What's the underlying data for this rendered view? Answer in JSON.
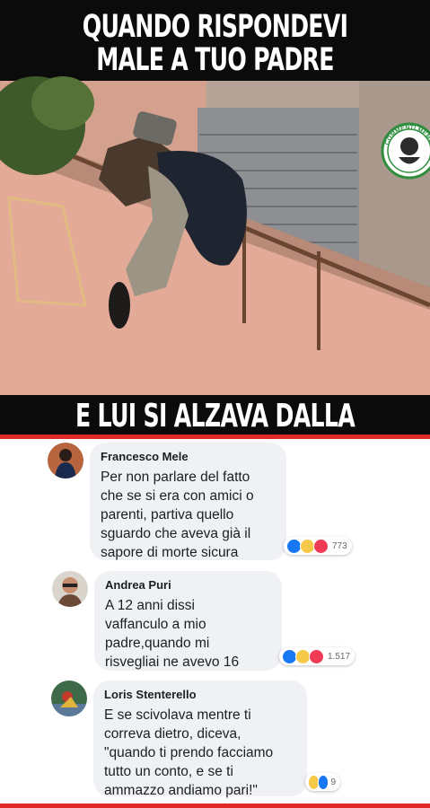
{
  "meme": {
    "top_caption_line1": "QUANDO RISPONDEVI",
    "top_caption_line2": "MALE A TUO PADRE",
    "bottom_caption": "E LUI SI ALZAVA DALLA SEDIA",
    "badge_text": "COMMENTI MEMORABILI"
  },
  "comments": [
    {
      "author": "Francesco Mele",
      "text": "Per non parlare del fatto\nche se si era con amici o\nparenti, partiva quello\nsguardo che aveva già il\nsapore di morte sicura",
      "reactions": [
        "like",
        "haha",
        "love"
      ],
      "count": "773"
    },
    {
      "author": "Andrea Puri",
      "text": "A 12 anni dissi\nvaffanculo a mio\npadre,quando mi\nrisvegliai ne avevo 16",
      "reactions": [
        "like",
        "haha",
        "love"
      ],
      "count": "1.517"
    },
    {
      "author": "Loris Stenterello",
      "text": "E se scivolava mentre ti\ncorreva dietro, diceva,\n\"quando ti prendo facciamo\ntutto un conto, e se ti\nammazzo andiamo pari!\"",
      "reactions": [
        "haha",
        "like"
      ],
      "count": "9"
    }
  ],
  "colors": {
    "accent_red": "#e02a2a",
    "bubble_bg": "#eff1f4",
    "like_blue": "#1877f2",
    "haha_yellow": "#f7c948",
    "love_red": "#ef3b56"
  }
}
